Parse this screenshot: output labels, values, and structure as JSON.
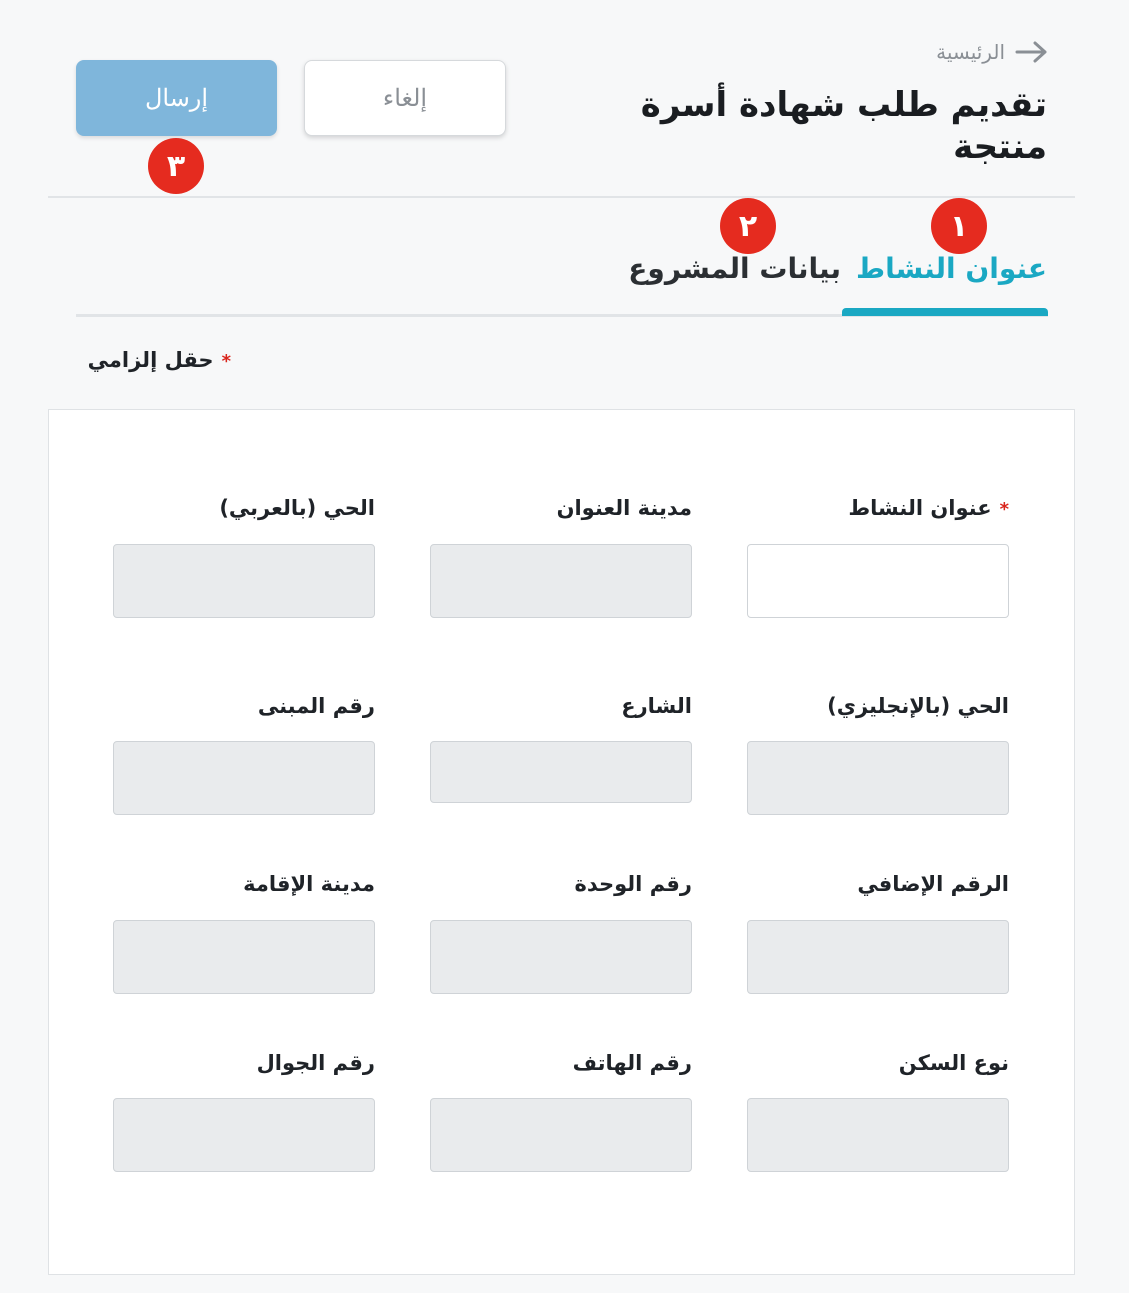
{
  "header": {
    "breadcrumb_label": "الرئيسية",
    "title": "تقديم طلب شهادة أسرة منتجة",
    "submit_label": "إرسال",
    "cancel_label": "إلغاء"
  },
  "badges": [
    "١",
    "٢",
    "٣"
  ],
  "tabs": [
    {
      "label": "عنوان النشاط",
      "active": true
    },
    {
      "label": "بيانات المشروع",
      "active": false
    }
  ],
  "required_note": "حقل إلزامي",
  "form": {
    "fields": [
      {
        "label": "عنوان النشاط",
        "required": true,
        "value": "",
        "disabled": false
      },
      {
        "label": "مدينة العنوان",
        "required": false,
        "value": "",
        "disabled": true
      },
      {
        "label": "الحي (بالعربي)",
        "required": false,
        "value": "",
        "disabled": true
      },
      {
        "label": "الحي (بالإنجليزي)",
        "required": false,
        "value": "",
        "disabled": true
      },
      {
        "label": "الشارع",
        "required": false,
        "value": "",
        "disabled": true
      },
      {
        "label": "رقم المبنى",
        "required": false,
        "value": "",
        "disabled": true
      },
      {
        "label": "الرقم الإضافي",
        "required": false,
        "value": "",
        "disabled": true
      },
      {
        "label": "رقم الوحدة",
        "required": false,
        "value": "",
        "disabled": true
      },
      {
        "label": "مدينة الإقامة",
        "required": false,
        "value": "",
        "disabled": true
      },
      {
        "label": "نوع السكن",
        "required": false,
        "value": "",
        "disabled": true
      },
      {
        "label": "رقم الهاتف",
        "required": false,
        "value": "",
        "disabled": true
      },
      {
        "label": "رقم الجوال",
        "required": false,
        "value": "",
        "disabled": true
      }
    ]
  },
  "colors": {
    "accent": "#1aa8c3",
    "submit": "#7fb6db",
    "badge": "#e52b1f",
    "required": "#d9251c"
  }
}
